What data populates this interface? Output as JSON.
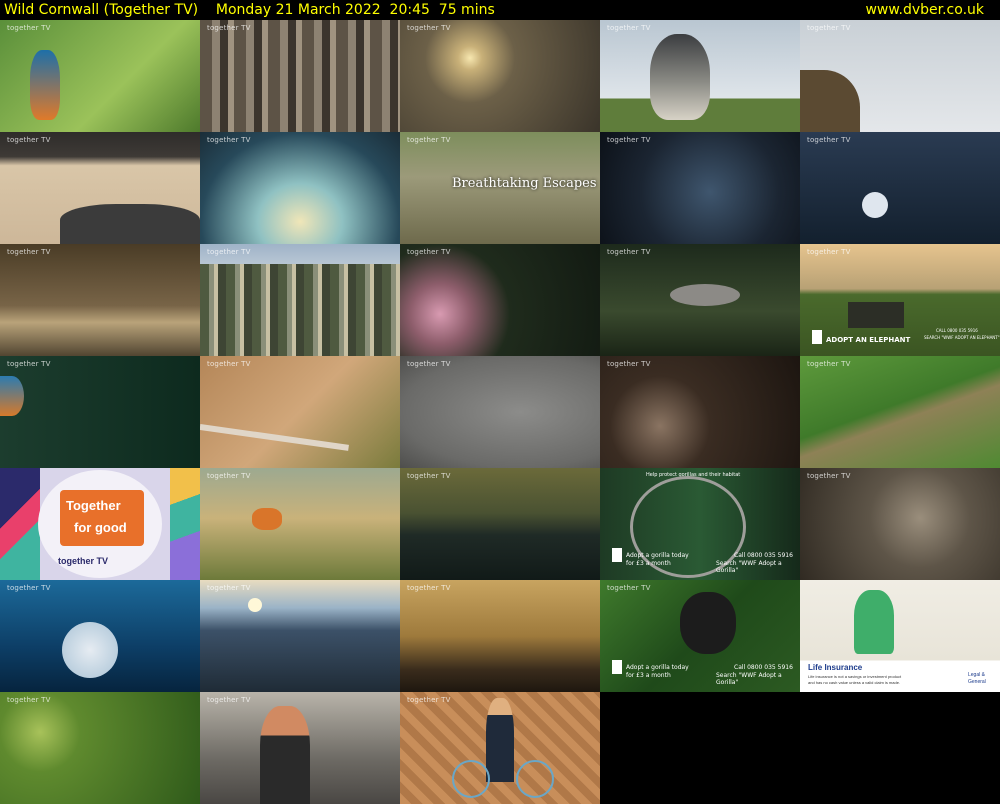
{
  "header": {
    "title": "Wild Cornwall (Together TV)    Monday 21 March 2022  20:45  75 mins",
    "site": "www.dvber.co.uk"
  },
  "watermark": "together TV",
  "thumbs": {
    "t7": {
      "overlay": "Breathtaking Escapes"
    },
    "t15": {
      "line1": "ADOPT AN ELEPHANT",
      "line2": "CALL 0800 035 5916",
      "line3": "SEARCH \"WWF ADOPT AN ELEPHANT\""
    },
    "t21": {
      "line1": "Together",
      "line2": "for good",
      "logo": "together TV"
    },
    "t24": {
      "top": "Help protect gorillas and their habitat",
      "line1": "Adopt a gorilla today",
      "line2": "for £3 a month",
      "line3": "Call 0800 035 5916",
      "line4": "Search \"WWF Adopt a Gorilla\""
    },
    "t29": {
      "line1": "Adopt a gorilla today",
      "line2": "for £3 a month",
      "line3": "Call 0800 035 5916",
      "line4": "Search \"WWF Adopt a Gorilla\""
    },
    "t30": {
      "heading": "Life Insurance",
      "line1": "Life insurance is not a savings or investment product",
      "line2": "and has no cash value unless a valid claim is made.",
      "brand1": "Legal &",
      "brand2": "General"
    }
  }
}
